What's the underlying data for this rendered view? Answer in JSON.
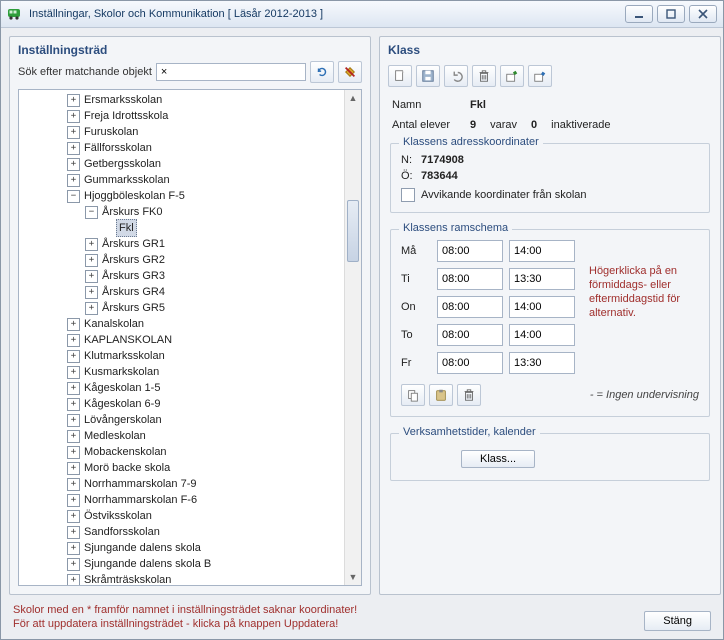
{
  "window": {
    "title": "Inställningar, Skolor och Kommunikation [ Läsår 2012-2013 ]"
  },
  "left_panel": {
    "title": "Inställningsträd",
    "search_label": "Sök efter matchande objekt",
    "search_value": "×"
  },
  "tree": {
    "indent_base": 48,
    "items": [
      {
        "label": "Ersmarksskolan",
        "exp": "+",
        "lvl": 0
      },
      {
        "label": "Freja Idrottsskola",
        "exp": "+",
        "lvl": 0
      },
      {
        "label": "Furuskolan",
        "exp": "+",
        "lvl": 0
      },
      {
        "label": "Fällforsskolan",
        "exp": "+",
        "lvl": 0
      },
      {
        "label": "Getbergsskolan",
        "exp": "+",
        "lvl": 0
      },
      {
        "label": "Gummarksskolan",
        "exp": "+",
        "lvl": 0
      },
      {
        "label": "Hjoggböleskolan F-5",
        "exp": "−",
        "lvl": 0
      },
      {
        "label": "Årskurs FK0",
        "exp": "−",
        "lvl": 1
      },
      {
        "label": "Fkl",
        "exp": "",
        "lvl": 2,
        "selected": true
      },
      {
        "label": "Årskurs GR1",
        "exp": "+",
        "lvl": 1
      },
      {
        "label": "Årskurs GR2",
        "exp": "+",
        "lvl": 1
      },
      {
        "label": "Årskurs GR3",
        "exp": "+",
        "lvl": 1
      },
      {
        "label": "Årskurs GR4",
        "exp": "+",
        "lvl": 1
      },
      {
        "label": "Årskurs GR5",
        "exp": "+",
        "lvl": 1
      },
      {
        "label": "Kanalskolan",
        "exp": "+",
        "lvl": 0
      },
      {
        "label": "KAPLANSKOLAN",
        "exp": "+",
        "lvl": 0
      },
      {
        "label": "Klutmarksskolan",
        "exp": "+",
        "lvl": 0
      },
      {
        "label": "Kusmarkskolan",
        "exp": "+",
        "lvl": 0
      },
      {
        "label": "Kågeskolan 1-5",
        "exp": "+",
        "lvl": 0
      },
      {
        "label": "Kågeskolan 6-9",
        "exp": "+",
        "lvl": 0
      },
      {
        "label": "Lövångerskolan",
        "exp": "+",
        "lvl": 0
      },
      {
        "label": "Medleskolan",
        "exp": "+",
        "lvl": 0
      },
      {
        "label": "Mobackenskolan",
        "exp": "+",
        "lvl": 0
      },
      {
        "label": "Morö backe skola",
        "exp": "+",
        "lvl": 0
      },
      {
        "label": "Norrhammarskolan 7-9",
        "exp": "+",
        "lvl": 0
      },
      {
        "label": "Norrhammarskolan F-6",
        "exp": "+",
        "lvl": 0
      },
      {
        "label": "Östviksskolan",
        "exp": "+",
        "lvl": 0
      },
      {
        "label": "Sandforsskolan",
        "exp": "+",
        "lvl": 0
      },
      {
        "label": "Sjungande dalens skola",
        "exp": "+",
        "lvl": 0
      },
      {
        "label": "Sjungande dalens skola B",
        "exp": "+",
        "lvl": 0
      },
      {
        "label": "Skråmträskskolan",
        "exp": "+",
        "lvl": 0
      }
    ]
  },
  "right_panel": {
    "title": "Klass",
    "name_label": "Namn",
    "name_value": "Fkl",
    "count_label": "Antal elever",
    "count_value": "9",
    "varav_label": "varav",
    "inactive_value": "0",
    "inactive_label": "inaktiverade",
    "coords": {
      "title": "Klassens adresskoordinater",
      "n_label": "N:",
      "n_value": "7174908",
      "o_label": "Ö:",
      "o_value": "783644",
      "deviating_label": "Avvikande koordinater från skolan"
    },
    "schedule": {
      "title": "Klassens ramschema",
      "days": {
        "ma": {
          "label": "Må",
          "am": "08:00",
          "pm": "14:00"
        },
        "ti": {
          "label": "Ti",
          "am": "08:00",
          "pm": "13:30"
        },
        "on": {
          "label": "On",
          "am": "08:00",
          "pm": "14:00"
        },
        "to": {
          "label": "To",
          "am": "08:00",
          "pm": "14:00"
        },
        "fr": {
          "label": "Fr",
          "am": "08:00",
          "pm": "13:30"
        }
      },
      "hint": "Högerklicka på en förmiddags- eller eftermiddagstid för alternativ.",
      "legend": "- = Ingen undervisning"
    },
    "activity": {
      "title": "Verksamhetstider, kalender",
      "button": "Klass..."
    }
  },
  "footer": {
    "note1": "Skolor med en * framför namnet i inställningsträdet saknar koordinater!",
    "note2": "För att uppdatera inställningsträdet - klicka på knappen Uppdatera!",
    "close": "Stäng"
  }
}
